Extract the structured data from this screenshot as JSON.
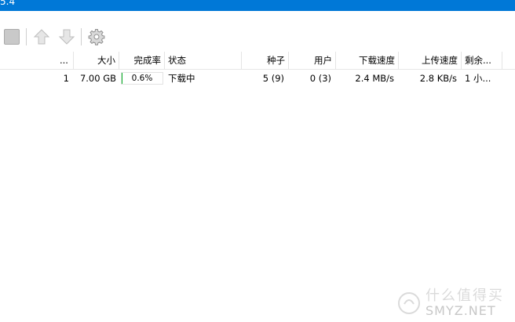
{
  "window": {
    "title_fragment": "5.4",
    "accent_color": "#0078d7"
  },
  "toolbar": {
    "stop_icon": "stop-square-icon",
    "move_up_icon": "arrow-up-icon",
    "move_down_icon": "arrow-down-icon",
    "settings_icon": "gear-icon"
  },
  "table": {
    "columns": {
      "index": "...",
      "size": "大小",
      "done": "完成率",
      "status": "状态",
      "seeds": "种子",
      "peers": "用户",
      "down_speed": "下载速度",
      "up_speed": "上传速度",
      "eta": "剩余..."
    },
    "rows": [
      {
        "index": "1",
        "size": "7.00 GB",
        "done": "0.6%",
        "done_fraction": 0.006,
        "status": "下载中",
        "seeds": "5 (9)",
        "peers": "0 (3)",
        "down_speed": "2.4 MB/s",
        "up_speed": "2.8 KB/s",
        "eta": "1 小..."
      }
    ]
  },
  "watermark": {
    "cn": "什么值得买",
    "en": "SMYZ.NET"
  }
}
